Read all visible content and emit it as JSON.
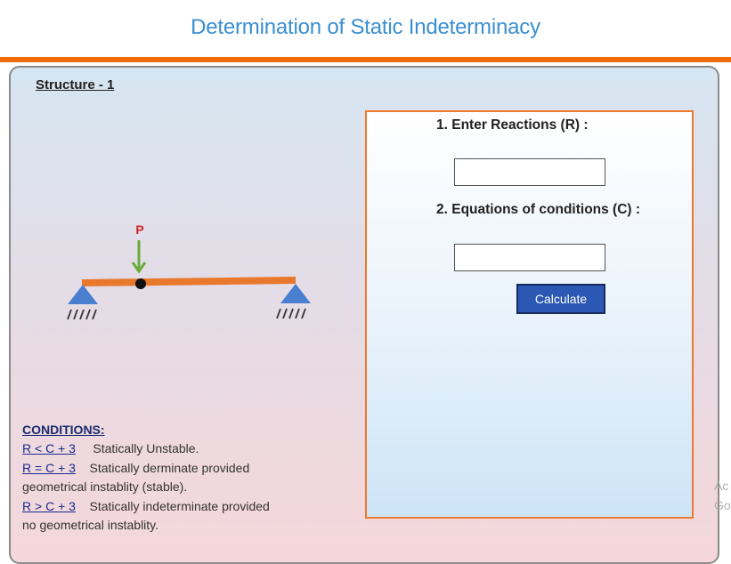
{
  "header": {
    "title": "Determination of Static Indeterminacy"
  },
  "structure": {
    "title": "Structure - 1",
    "load_label": "P"
  },
  "form": {
    "reactions_label": "1. Enter Reactions (R) :",
    "reactions_value": "",
    "conditions_label": "2. Equations of conditions (C) :",
    "conditions_value": "",
    "calculate_label": "Calculate"
  },
  "conditions": {
    "heading": "CONDITIONS:",
    "items": [
      {
        "relation": "R < C + 3",
        "text": "Statically Unstable."
      },
      {
        "relation": "R = C + 3",
        "text": "Statically derminate provided",
        "continuation": "geometrical instablity (stable)."
      },
      {
        "relation": "R > C + 3",
        "text": "Statically indeterminate provided",
        "continuation": "no geometrical instablity."
      }
    ]
  },
  "watermark": {
    "line1": "Ac",
    "line2": "Go"
  },
  "colors": {
    "title": "#3a8fd0",
    "accent_bar": "#f26b0a",
    "beam": "#e8792c",
    "support": "#4a7fd0",
    "load_arrow": "#6aaa3a",
    "load_label": "#cc2222",
    "button": "#2a58b2"
  }
}
